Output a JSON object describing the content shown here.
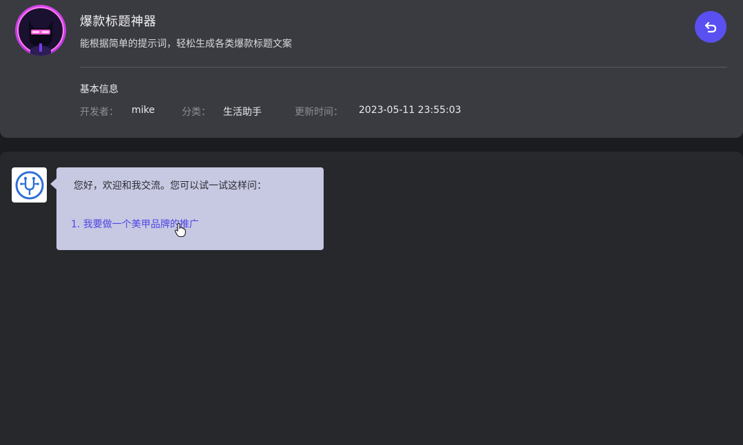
{
  "header": {
    "avatar_icon": "cyber-cat-avatar",
    "title": "爆款标题神器",
    "description": "能根据简单的提示词，轻松生成各类爆款标题文案",
    "back_icon": "undo-arrow-icon",
    "back_button_color": "#5a4ff0"
  },
  "info": {
    "section_title": "基本信息",
    "developer_label": "开发者：",
    "developer_value": "mike",
    "category_label": "分类：",
    "category_value": "生活助手",
    "updated_label": "更新时间：",
    "updated_value": "2023-05-11 23:55:03"
  },
  "chat": {
    "bot_avatar_icon": "circuit-logo-icon",
    "bubble_color": "#c7c8e2",
    "greeting": "您好，欢迎和我交流。您可以试一试这样问：",
    "suggestions": [
      "1.  我要做一个美甲品牌的推广"
    ],
    "link_color": "#4f46e5"
  }
}
